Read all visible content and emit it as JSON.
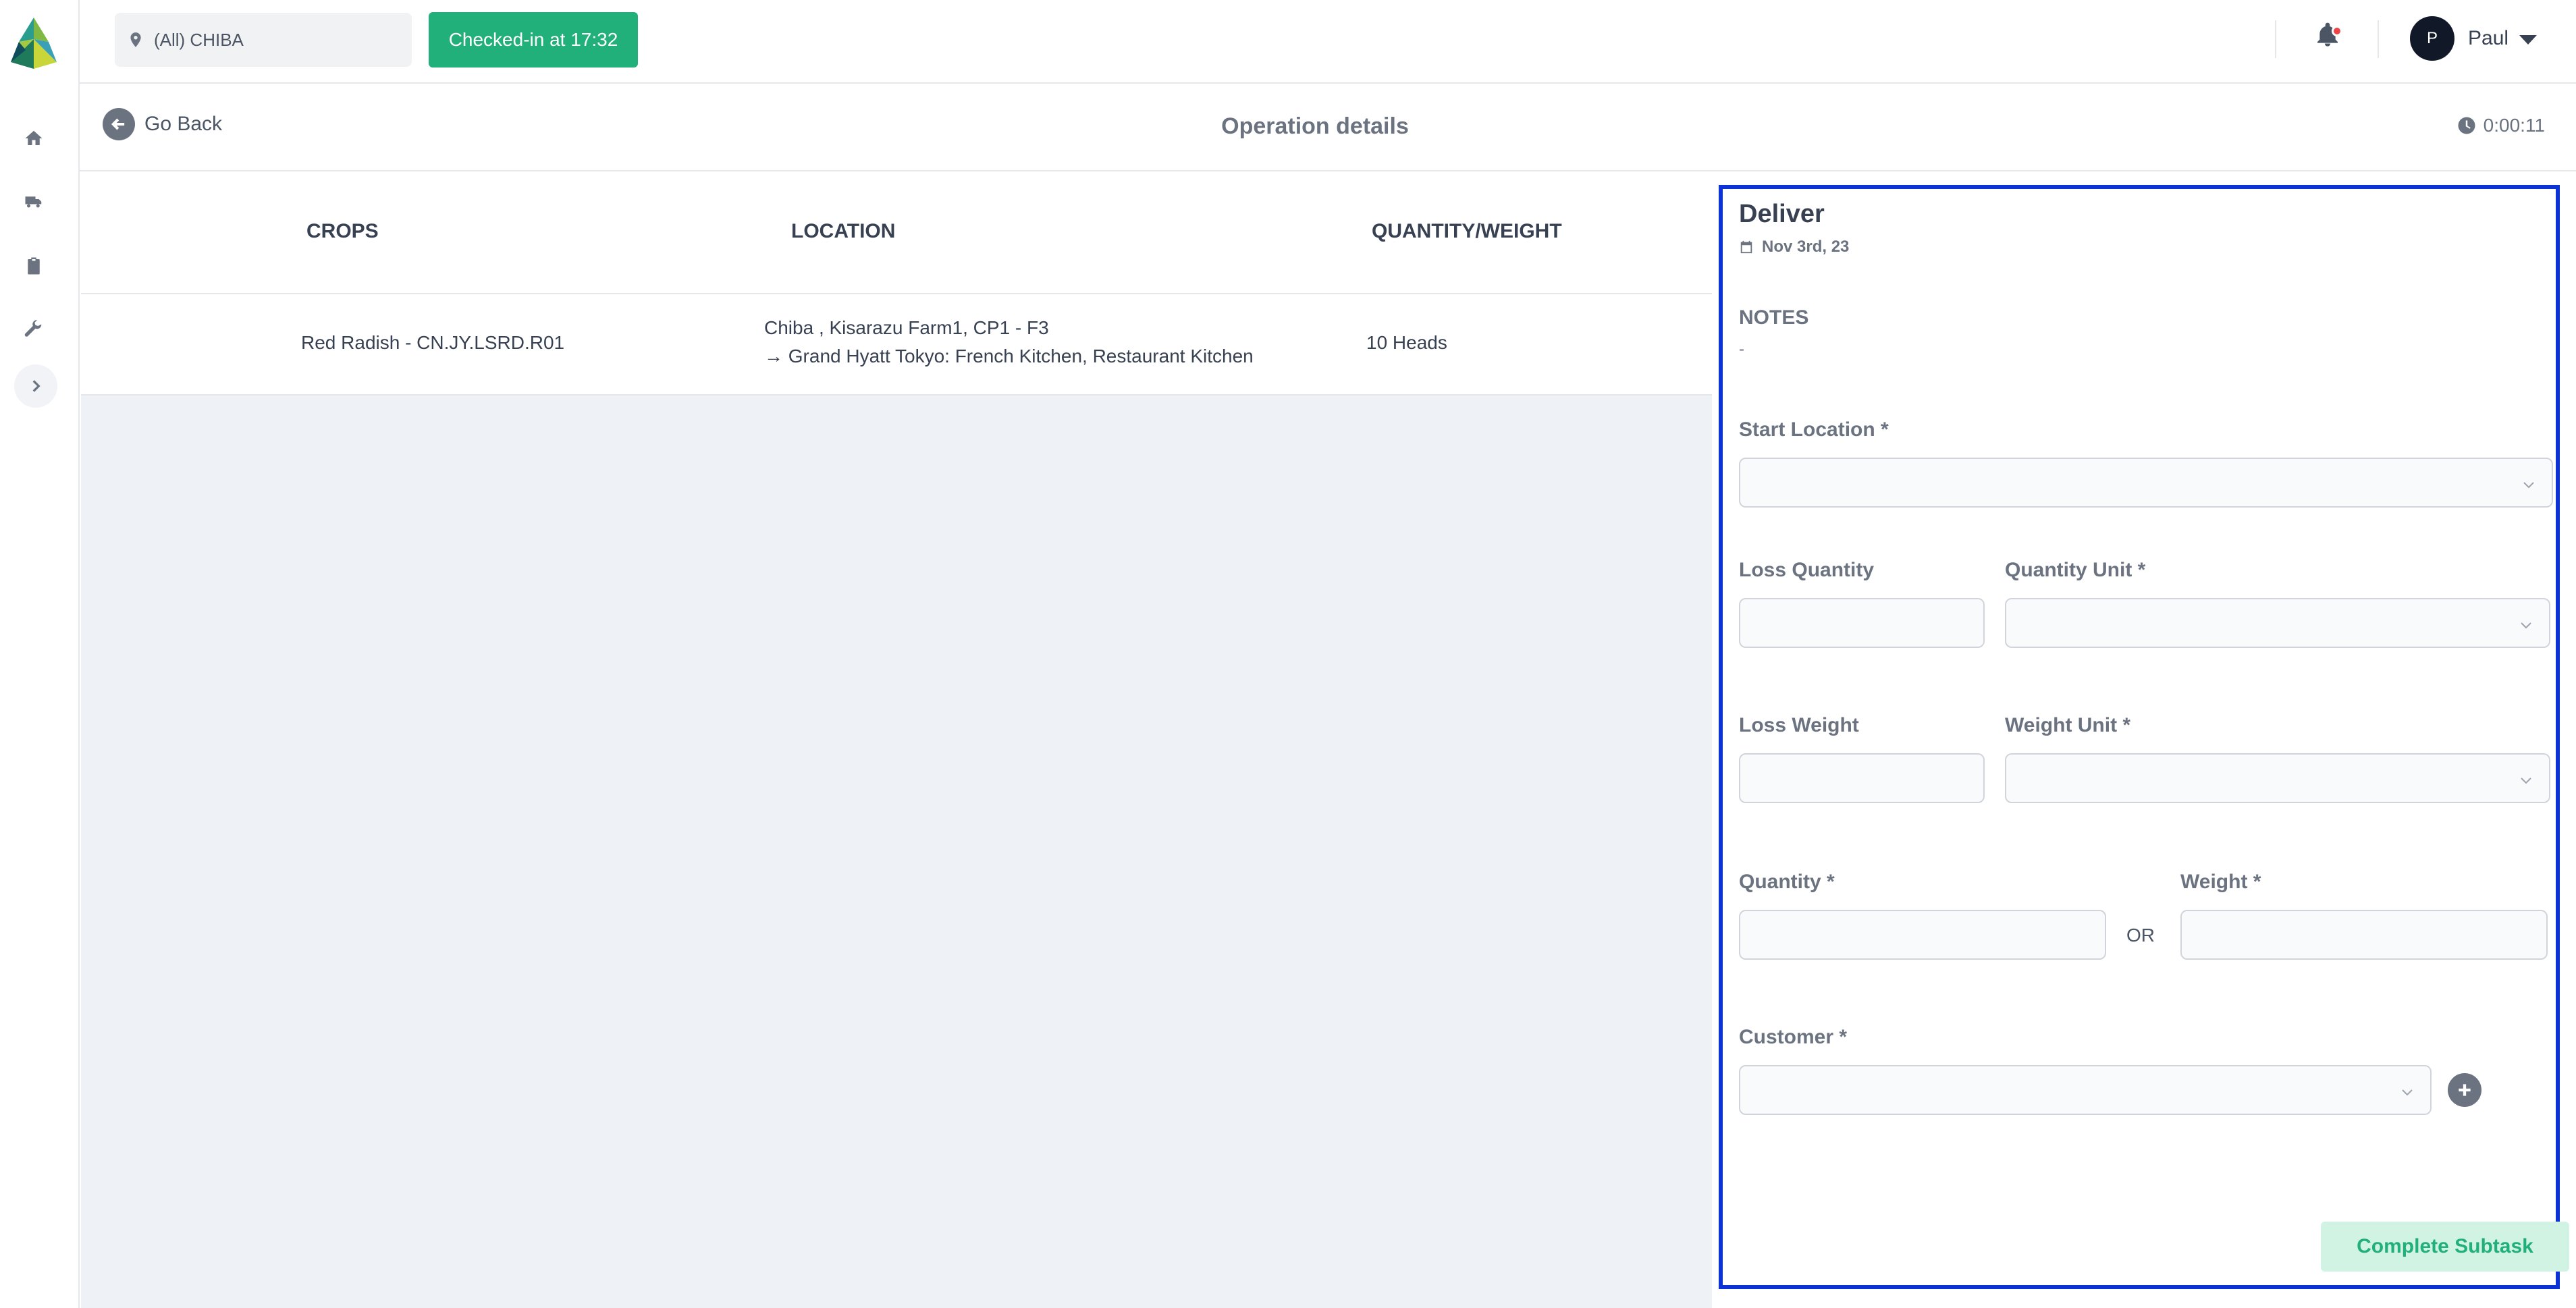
{
  "app": {
    "brand_colors": {
      "primary": "#22b07a",
      "focus_border": "#0b33d6",
      "dark": "#111827"
    }
  },
  "sidebar": {
    "items": [
      {
        "name": "home-icon"
      },
      {
        "name": "truck-icon"
      },
      {
        "name": "clipboard-icon"
      },
      {
        "name": "wrench-icon"
      }
    ],
    "expand_icon": "chevron-right-icon"
  },
  "topbar": {
    "location_label": "(All) CHIBA",
    "checkin_label": "Checked-in at 17:32",
    "user_initial": "P",
    "user_name": "Paul"
  },
  "subheader": {
    "back_label": "Go Back",
    "title": "Operation details",
    "timer": "0:00:11"
  },
  "table": {
    "headers": [
      "CROPS",
      "LOCATION",
      "QUANTITY/WEIGHT"
    ],
    "rows": [
      {
        "crop": "Red Radish - CN.JY.LSRD.R01",
        "location_from": "Chiba , Kisarazu Farm1, CP1 - F3",
        "location_to": "→ Grand Hyatt Tokyo: French Kitchen, Restaurant Kitchen",
        "quantity": "10 Heads"
      }
    ]
  },
  "panel": {
    "title": "Deliver",
    "date": "Nov 3rd, 23",
    "notes_label": "NOTES",
    "notes_value": "-",
    "start_location_label": "Start Location *",
    "loss_quantity_label": "Loss Quantity",
    "quantity_unit_label": "Quantity Unit *",
    "loss_weight_label": "Loss Weight",
    "weight_unit_label": "Weight Unit *",
    "quantity_label": "Quantity *",
    "or_label": "OR",
    "weight_label": "Weight *",
    "customer_label": "Customer *",
    "complete_label": "Complete Subtask"
  }
}
